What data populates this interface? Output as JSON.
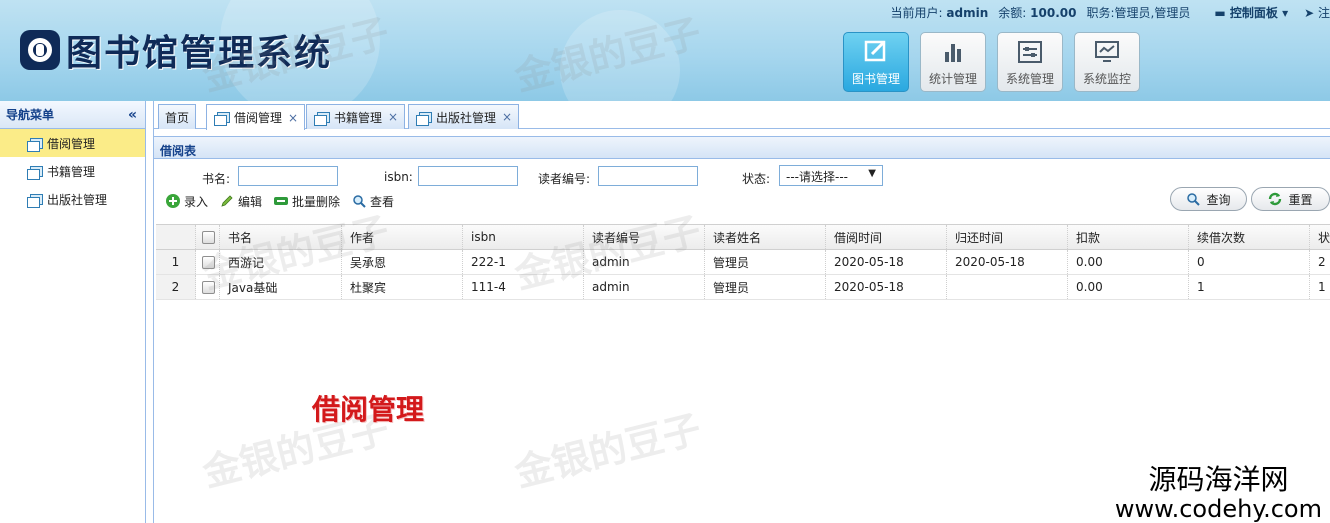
{
  "header": {
    "logo_text": "图书馆管理系统",
    "user": {
      "label": "当前用户:",
      "name": "admin"
    },
    "balance": {
      "label": "余额:",
      "value": "100.00"
    },
    "role": {
      "label": "职务:",
      "value": "管理员,管理员"
    },
    "control_panel": "控制面板",
    "logout_partial": "注",
    "nav": [
      {
        "label": "图书管理",
        "icon": "edit-icon"
      },
      {
        "label": "统计管理",
        "icon": "bar-chart-icon"
      },
      {
        "label": "系统管理",
        "icon": "settings-sliders-icon"
      },
      {
        "label": "系统监控",
        "icon": "monitor-icon"
      }
    ]
  },
  "sidebar": {
    "title": "导航菜单",
    "collapse_icon": "«",
    "items": [
      {
        "label": "借阅管理",
        "active": true
      },
      {
        "label": "书籍管理",
        "active": false
      },
      {
        "label": "出版社管理",
        "active": false
      }
    ]
  },
  "tabs": [
    {
      "label": "首页",
      "closable": false
    },
    {
      "label": "借阅管理",
      "closable": true,
      "active": true
    },
    {
      "label": "书籍管理",
      "closable": true
    },
    {
      "label": "出版社管理",
      "closable": true
    }
  ],
  "panel": {
    "title": "借阅表"
  },
  "search": {
    "book_label": "书名:",
    "isbn_label": "isbn:",
    "reader_label": "读者编号:",
    "status_label": "状态:",
    "status_selected": "---请选择---",
    "query_button": "查询",
    "reset_button": "重置"
  },
  "toolbar": {
    "add": "录入",
    "edit": "编辑",
    "batch_delete": "批量删除",
    "view": "查看"
  },
  "table": {
    "columns": [
      "书名",
      "作者",
      "isbn",
      "读者编号",
      "读者姓名",
      "借阅时间",
      "归还时间",
      "扣款",
      "续借次数",
      "状"
    ],
    "rows": [
      {
        "no": "1",
        "cells": [
          "西游记",
          "吴承恩",
          "222-1",
          "admin",
          "管理员",
          "2020-05-18",
          "2020-05-18",
          "0.00",
          "0",
          "2"
        ]
      },
      {
        "no": "2",
        "cells": [
          "Java基础",
          "杜聚宾",
          "111-4",
          "admin",
          "管理员",
          "2020-05-18",
          "",
          "0.00",
          "1",
          "1"
        ]
      }
    ]
  },
  "overlay": {
    "watermark": "金银的豆子",
    "caption": "借阅管理",
    "brand_cn": "源码海洋网",
    "brand_url": "www.codehy.com"
  }
}
